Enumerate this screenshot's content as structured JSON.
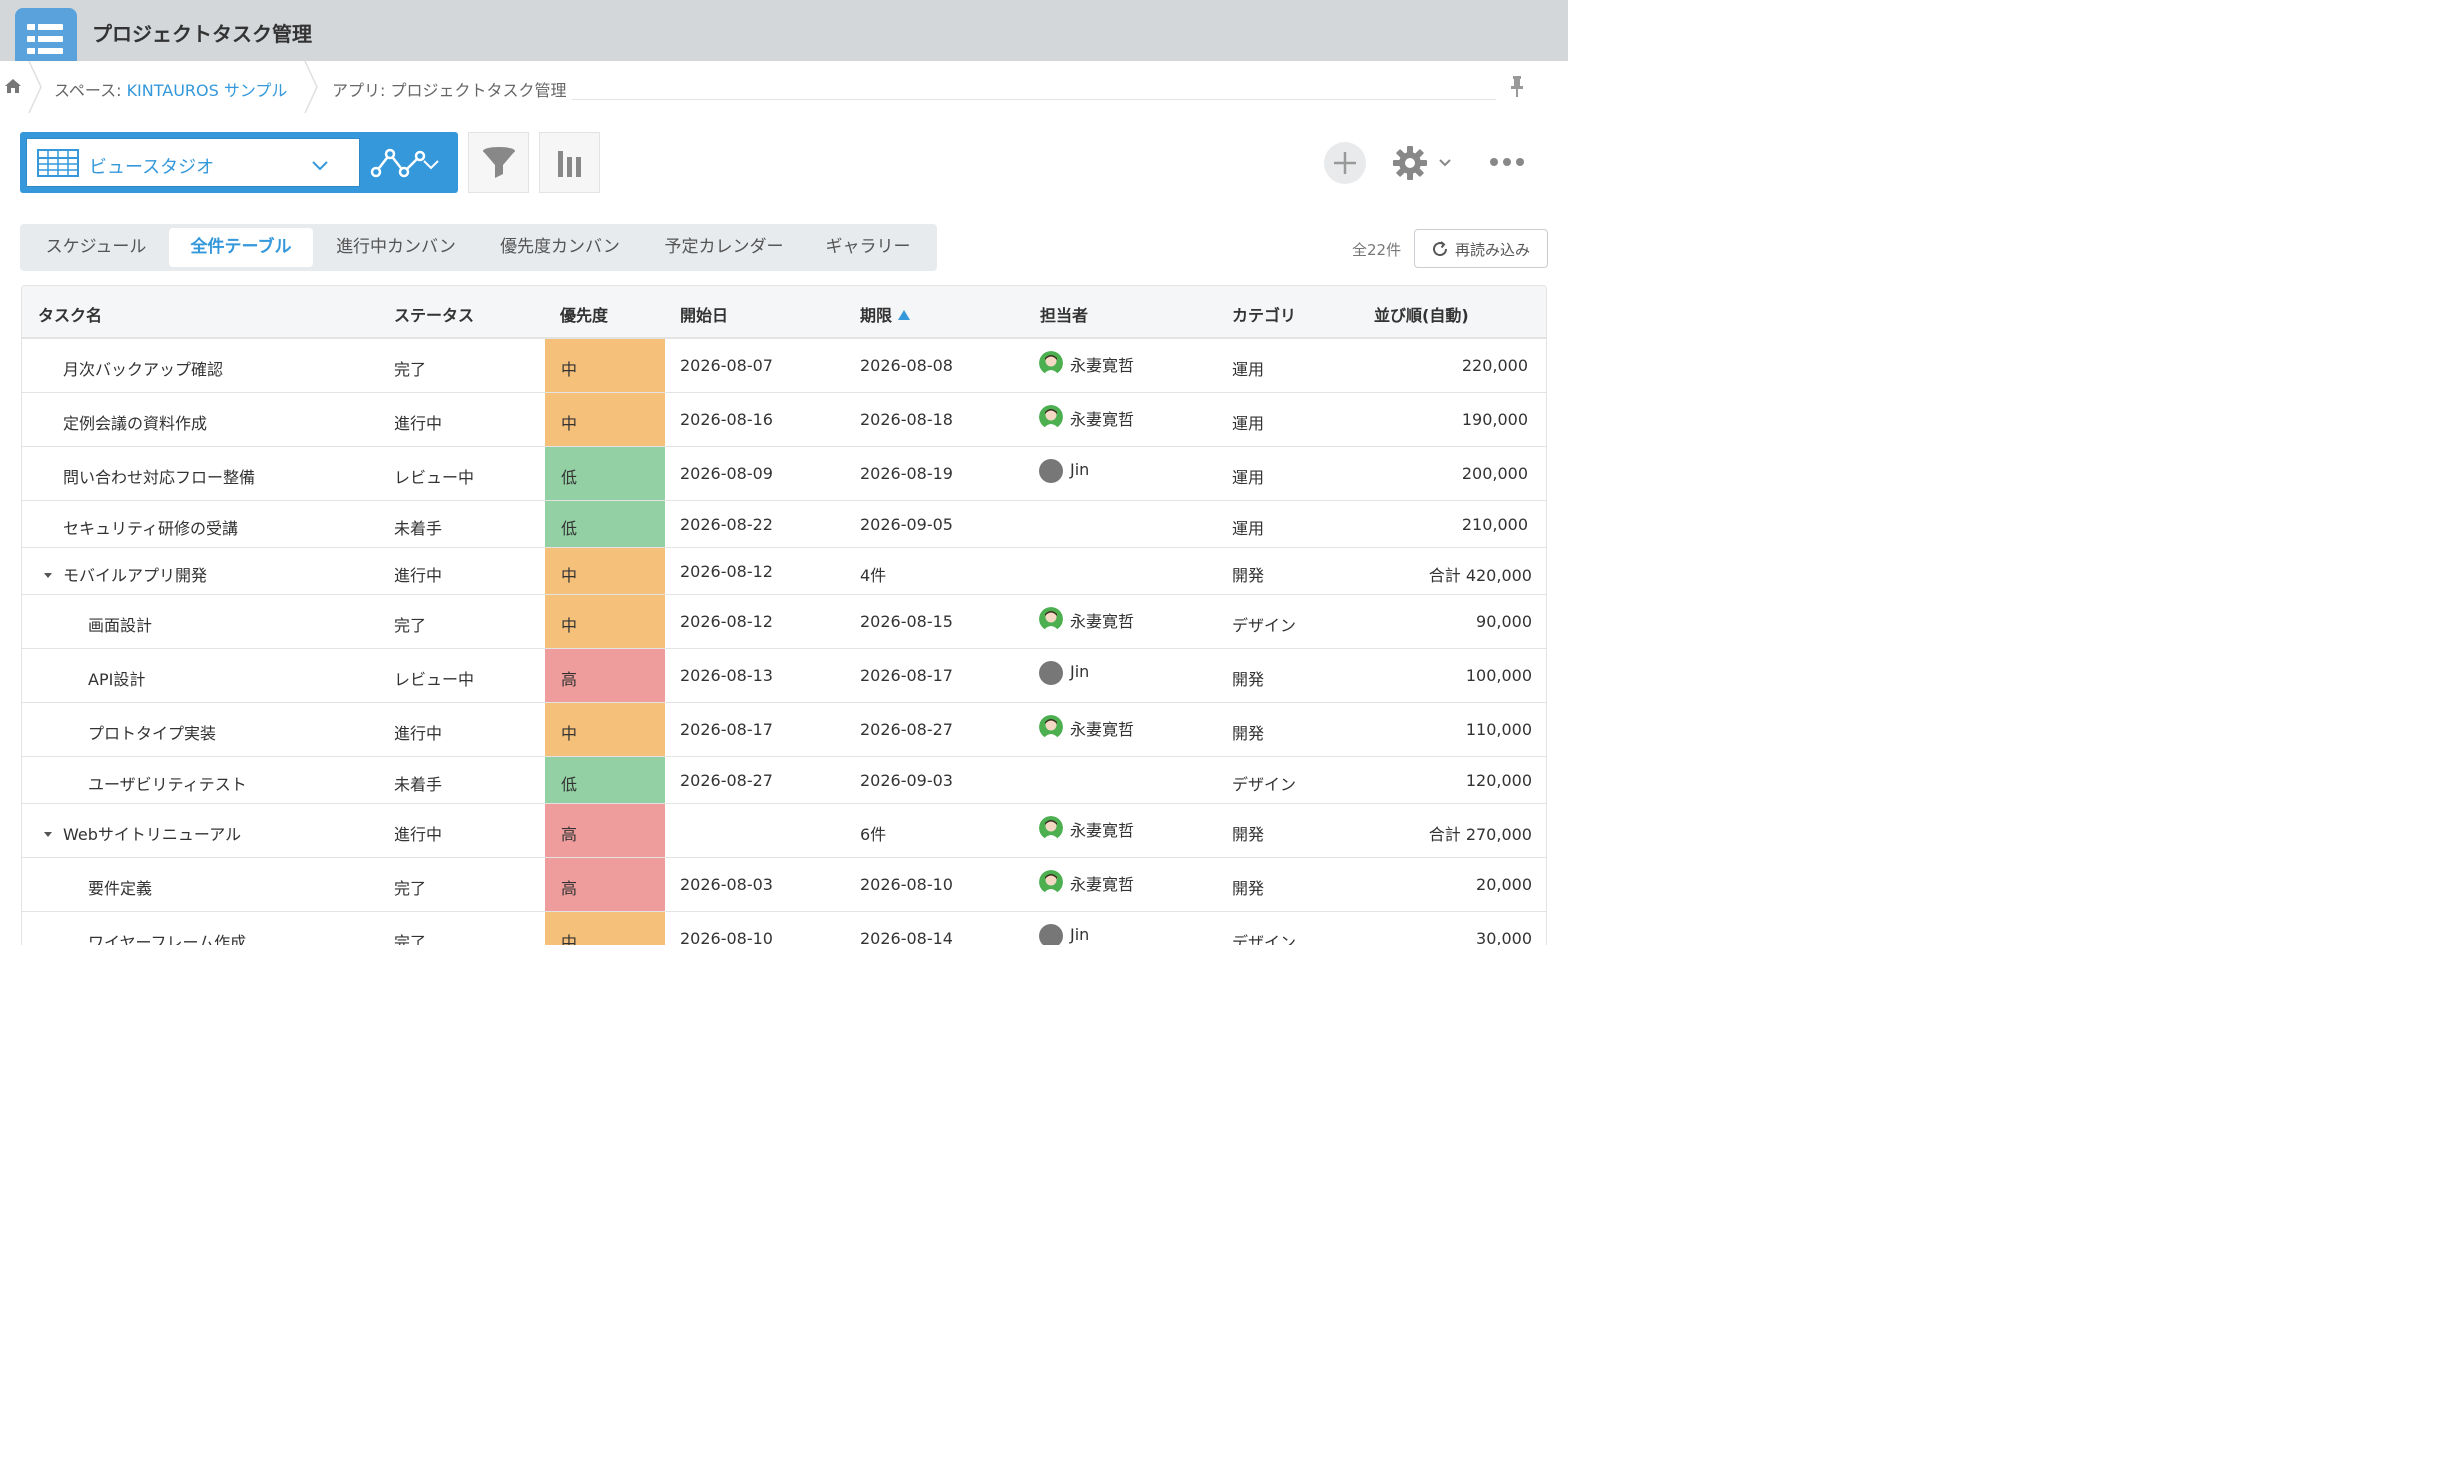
{
  "header": {
    "app_title": "プロジェクトタスク管理"
  },
  "breadcrumb": {
    "space_prefix": "スペース: ",
    "space_name": "KINTAUROS サンプル",
    "app_label": "アプリ: プロジェクトタスク管理"
  },
  "toolbar": {
    "view_name": "ビュースタジオ"
  },
  "tabs": [
    {
      "label": "スケジュール"
    },
    {
      "label": "全件テーブル"
    },
    {
      "label": "進行中カンバン"
    },
    {
      "label": "優先度カンバン"
    },
    {
      "label": "予定カレンダー"
    },
    {
      "label": "ギャラリー"
    }
  ],
  "active_tab": "全件テーブル",
  "record_count": "全22件",
  "reload_label": "再読み込み",
  "columns": [
    "タスク名",
    "ステータス",
    "優先度",
    "開始日",
    "期限",
    "担当者",
    "カテゴリ",
    "並び順(自動)"
  ],
  "sort": {
    "column": "期限",
    "direction": "ascending"
  },
  "priority_colors": {
    "中": "#f4c07a",
    "低": "#93d1a5",
    "高": "#ef9c9c"
  },
  "rows": [
    {
      "task": "月次バックアップ確認",
      "status": "完了",
      "priority": "中",
      "start": "2026-08-07",
      "due": "2026-08-08",
      "assignee": "永妻寛哲",
      "avatar": "green",
      "category": "運用",
      "order": "220,000"
    },
    {
      "task": "定例会議の資料作成",
      "status": "進行中",
      "priority": "中",
      "start": "2026-08-16",
      "due": "2026-08-18",
      "assignee": "永妻寛哲",
      "avatar": "green",
      "category": "運用",
      "order": "190,000"
    },
    {
      "task": "問い合わせ対応フロー整備",
      "status": "レビュー中",
      "priority": "低",
      "start": "2026-08-09",
      "due": "2026-08-19",
      "assignee": "Jin",
      "avatar": "gray",
      "category": "運用",
      "order": "200,000"
    },
    {
      "task": "セキュリティ研修の受講",
      "status": "未着手",
      "priority": "低",
      "start": "2026-08-22",
      "due": "2026-09-05",
      "assignee": "",
      "avatar": "",
      "category": "運用",
      "order": "210,000"
    },
    {
      "task": "モバイルアプリ開発",
      "status": "進行中",
      "priority": "中",
      "start": "2026-08-12",
      "due": "4件",
      "assignee": "",
      "avatar": "",
      "category": "開発",
      "order": "合計 420,000",
      "group": true
    },
    {
      "task": "画面設計",
      "status": "完了",
      "priority": "中",
      "start": "2026-08-12",
      "due": "2026-08-15",
      "assignee": "永妻寛哲",
      "avatar": "green",
      "category": "デザイン",
      "order": "90,000",
      "child": true
    },
    {
      "task": "API設計",
      "status": "レビュー中",
      "priority": "高",
      "start": "2026-08-13",
      "due": "2026-08-17",
      "assignee": "Jin",
      "avatar": "gray",
      "category": "開発",
      "order": "100,000",
      "child": true
    },
    {
      "task": "プロトタイプ実装",
      "status": "進行中",
      "priority": "中",
      "start": "2026-08-17",
      "due": "2026-08-27",
      "assignee": "永妻寛哲",
      "avatar": "green",
      "category": "開発",
      "order": "110,000",
      "child": true
    },
    {
      "task": "ユーザビリティテスト",
      "status": "未着手",
      "priority": "低",
      "start": "2026-08-27",
      "due": "2026-09-03",
      "assignee": "",
      "avatar": "",
      "category": "デザイン",
      "order": "120,000",
      "child": true
    },
    {
      "task": "Webサイトリニューアル",
      "status": "進行中",
      "priority": "高",
      "start": "",
      "due": "6件",
      "assignee": "永妻寛哲",
      "avatar": "green",
      "category": "開発",
      "order": "合計 270,000",
      "group": true
    },
    {
      "task": "要件定義",
      "status": "完了",
      "priority": "高",
      "start": "2026-08-03",
      "due": "2026-08-10",
      "assignee": "永妻寛哲",
      "avatar": "green",
      "category": "開発",
      "order": "20,000",
      "child": true
    },
    {
      "task": "ワイヤーフレーム作成",
      "status": "完了",
      "priority": "中",
      "start": "2026-08-10",
      "due": "2026-08-14",
      "assignee": "Jin",
      "avatar": "gray",
      "category": "デザイン",
      "order": "30,000",
      "child": true
    }
  ]
}
